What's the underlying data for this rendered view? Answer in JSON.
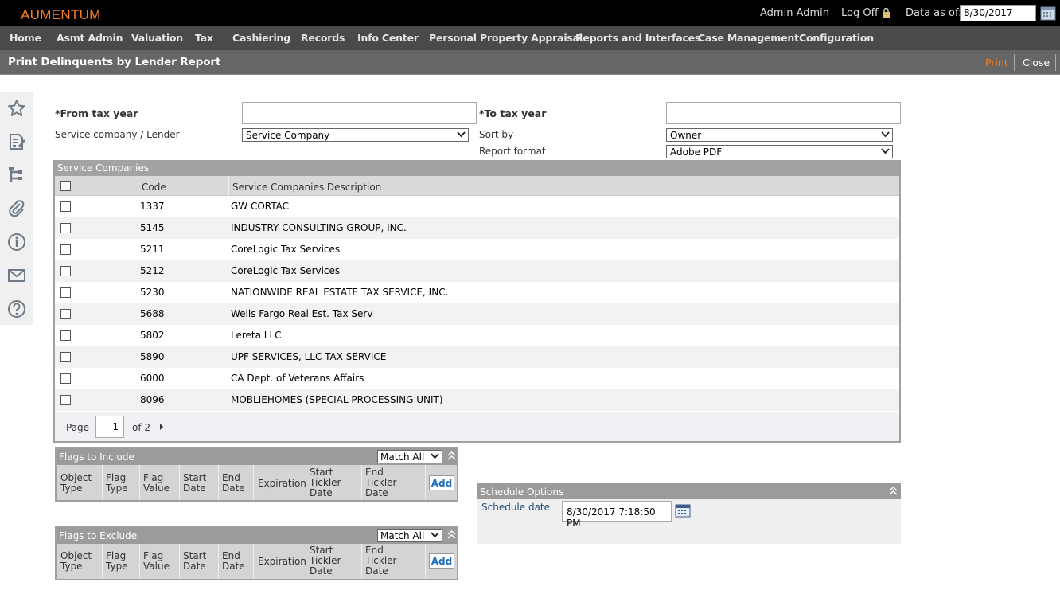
{
  "app": {
    "logo": "AUMENTUM"
  },
  "header": {
    "user": "Admin Admin",
    "logoff": "Log Off",
    "data_as_of_label": "Data as of:",
    "data_as_of_value": "8/30/2017"
  },
  "nav": {
    "items": [
      "Home",
      "Asmt Admin",
      "Valuation",
      "Tax",
      "Cashiering",
      "Records",
      "Info Center",
      "Personal Property Appraisal",
      "Reports and Interfaces",
      "Case Management",
      "Configuration"
    ]
  },
  "page": {
    "title": "Print Delinquents by Lender Report",
    "print": "Print",
    "close": "Close"
  },
  "sidebar": {
    "icons": [
      "star-icon",
      "edit-document-icon",
      "hierarchy-icon",
      "paperclip-icon",
      "info-icon",
      "mail-icon",
      "help-icon"
    ]
  },
  "form": {
    "from_tax_year_label": "*From tax year",
    "from_tax_year_value": "",
    "to_tax_year_label": "*To tax year",
    "to_tax_year_value": "",
    "service_label": "Service company / Lender",
    "service_value": "Service Company",
    "sort_label": "Sort by",
    "sort_value": "Owner",
    "format_label": "Report format",
    "format_value": "Adobe PDF"
  },
  "grid": {
    "title": "Service Companies",
    "columns": [
      "Code",
      "Service Companies Description"
    ],
    "rows": [
      {
        "code": "1337",
        "desc": "GW CORTAC"
      },
      {
        "code": "5145",
        "desc": "INDUSTRY CONSULTING GROUP, INC."
      },
      {
        "code": "5211",
        "desc": "CoreLogic Tax Services"
      },
      {
        "code": "5212",
        "desc": "CoreLogic Tax Services"
      },
      {
        "code": "5230",
        "desc": "NATIONWIDE REAL ESTATE TAX SERVICE, INC."
      },
      {
        "code": "5688",
        "desc": "Wells Fargo Real Est. Tax Serv"
      },
      {
        "code": "5802",
        "desc": "Lereta LLC"
      },
      {
        "code": "5890",
        "desc": "UPF SERVICES, LLC TAX SERVICE"
      },
      {
        "code": "6000",
        "desc": "CA Dept. of Veterans Affairs"
      },
      {
        "code": "8096",
        "desc": "MOBLIEHOMES (SPECIAL PROCESSING UNIT)"
      }
    ],
    "pager": {
      "page_label": "Page",
      "page_value": "1",
      "of_label": "of 2"
    }
  },
  "flags_include": {
    "title": "Flags to Include",
    "match": "Match All",
    "add": "Add",
    "columns": [
      "Object Type",
      "Flag Type",
      "Flag Value",
      "Start Date",
      "End Date",
      "Expiration",
      "Start Tickler Date",
      "End Tickler Date"
    ]
  },
  "flags_exclude": {
    "title": "Flags to Exclude",
    "match": "Match All",
    "add": "Add",
    "columns": [
      "Object Type",
      "Flag Type",
      "Flag Value",
      "Start Date",
      "End Date",
      "Expiration",
      "Start Tickler Date",
      "End Tickler Date"
    ]
  },
  "schedule": {
    "title": "Schedule Options",
    "date_label": "Schedule date",
    "date_value": "8/30/2017 7:18:50 PM"
  },
  "colors": {
    "accent": "#f47b20",
    "nav_bg": "#4a4a4a",
    "title_bg": "#666666",
    "link_blue": "#1d6fb8"
  }
}
